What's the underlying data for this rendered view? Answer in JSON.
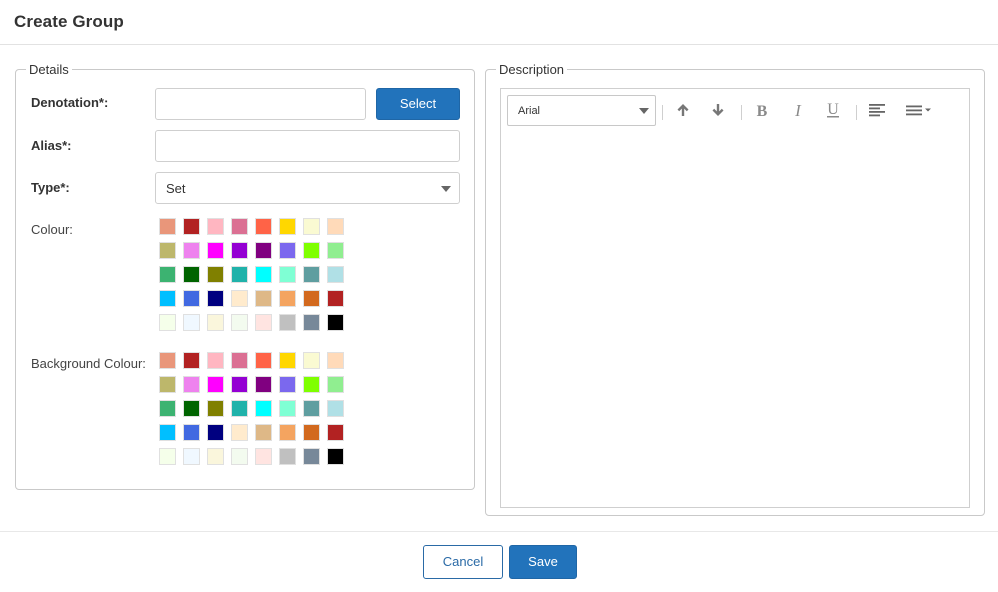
{
  "dialog": {
    "title": "Create Group"
  },
  "details": {
    "legend": "Details",
    "denotation_label": "Denotation*:",
    "denotation_value": "",
    "select_button": "Select",
    "alias_label": "Alias*:",
    "alias_value": "",
    "type_label": "Type*:",
    "type_value": "Set",
    "colour_label": "Colour:",
    "background_colour_label": "Background Colour:"
  },
  "palette": [
    "#E9967A",
    "#B22222",
    "#FFB6C1",
    "#DB7093",
    "#FF6347",
    "#FFD700",
    "#FAFAD2",
    "#FFDAB9",
    "#BDB76B",
    "#EE82EE",
    "#FF00FF",
    "#9400D3",
    "#800080",
    "#7B68EE",
    "#7FFF00",
    "#90EE90",
    "#3CB371",
    "#006400",
    "#808000",
    "#20B2AA",
    "#00FFFF",
    "#7FFFD4",
    "#5F9EA0",
    "#B0E0E6",
    "#00BFFF",
    "#4169E1",
    "#000080",
    "#FFEBCD",
    "#DEB887",
    "#F4A460",
    "#D2691E",
    "#B22222",
    "#F5FFEA",
    "#F0F8FF",
    "#FAF6DC",
    "#F3FBEF",
    "#FFE4E1",
    "#C0C0C0",
    "#778899",
    "#000000"
  ],
  "description": {
    "legend": "Description",
    "font": "Arial"
  },
  "footer": {
    "cancel": "Cancel",
    "save": "Save"
  }
}
